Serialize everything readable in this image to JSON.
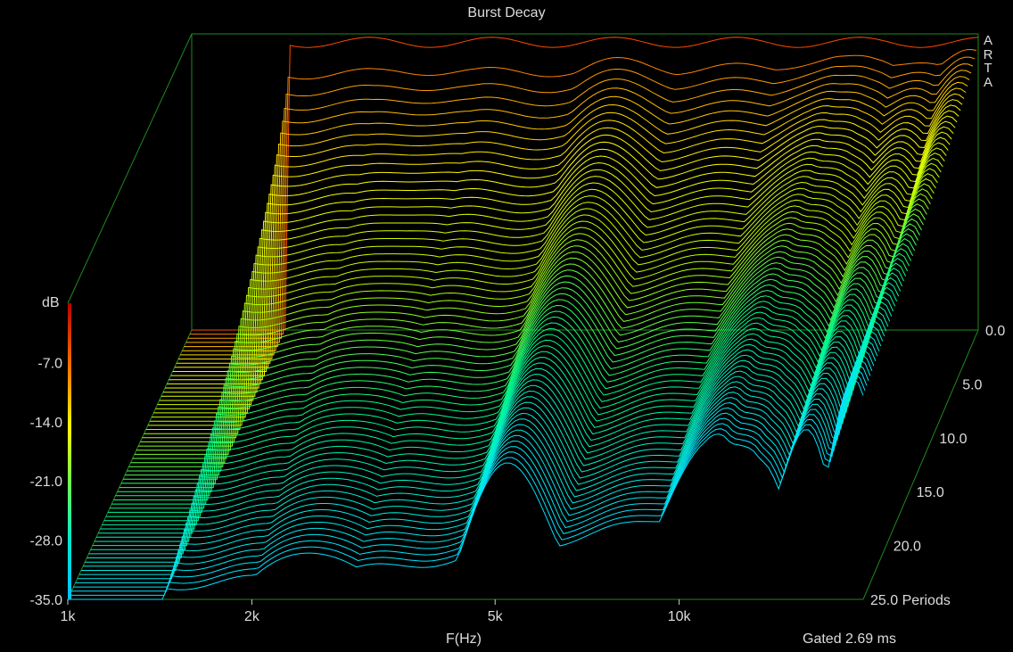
{
  "chart_data": {
    "type": "waterfall-3d",
    "title": "Burst Decay",
    "xlabel": "F(Hz)",
    "zlabel": "dB",
    "depth_unit": "Periods",
    "gating_note": "Gated 2.69 ms",
    "brand": "ARTA",
    "x_scale": "log",
    "x_range_hz": [
      1000,
      20000
    ],
    "x_ticks": [
      {
        "value": 1000,
        "label": "1k"
      },
      {
        "value": 2000,
        "label": "2k"
      },
      {
        "value": 5000,
        "label": "5k"
      },
      {
        "value": 10000,
        "label": "10k"
      }
    ],
    "z_range_db": [
      -35,
      0
    ],
    "z_ticks": [
      "dB",
      "-7.0",
      "-14.0",
      "-21.0",
      "-28.0",
      "-35.0"
    ],
    "depth_range_periods": [
      0,
      25
    ],
    "depth_ticks": [
      "0.0",
      "5.0",
      "10.0",
      "15.0",
      "20.0",
      "25.0 Periods"
    ],
    "colormap": [
      "#1d1dd6",
      "#1e90ff",
      "#00e5ff",
      "#00ff88",
      "#b8ff00",
      "#ffff00",
      "#ffa500",
      "#ff3300",
      "#c80000"
    ],
    "frame_color": "#1f8a1f",
    "grid": false,
    "slice_count": 66,
    "notes_db_profile": [
      {
        "f": 1000,
        "db": -35
      },
      {
        "f": 1400,
        "db": -35
      },
      {
        "f": 1500,
        "db": -1
      },
      {
        "f": 20000,
        "db": -1
      }
    ]
  }
}
